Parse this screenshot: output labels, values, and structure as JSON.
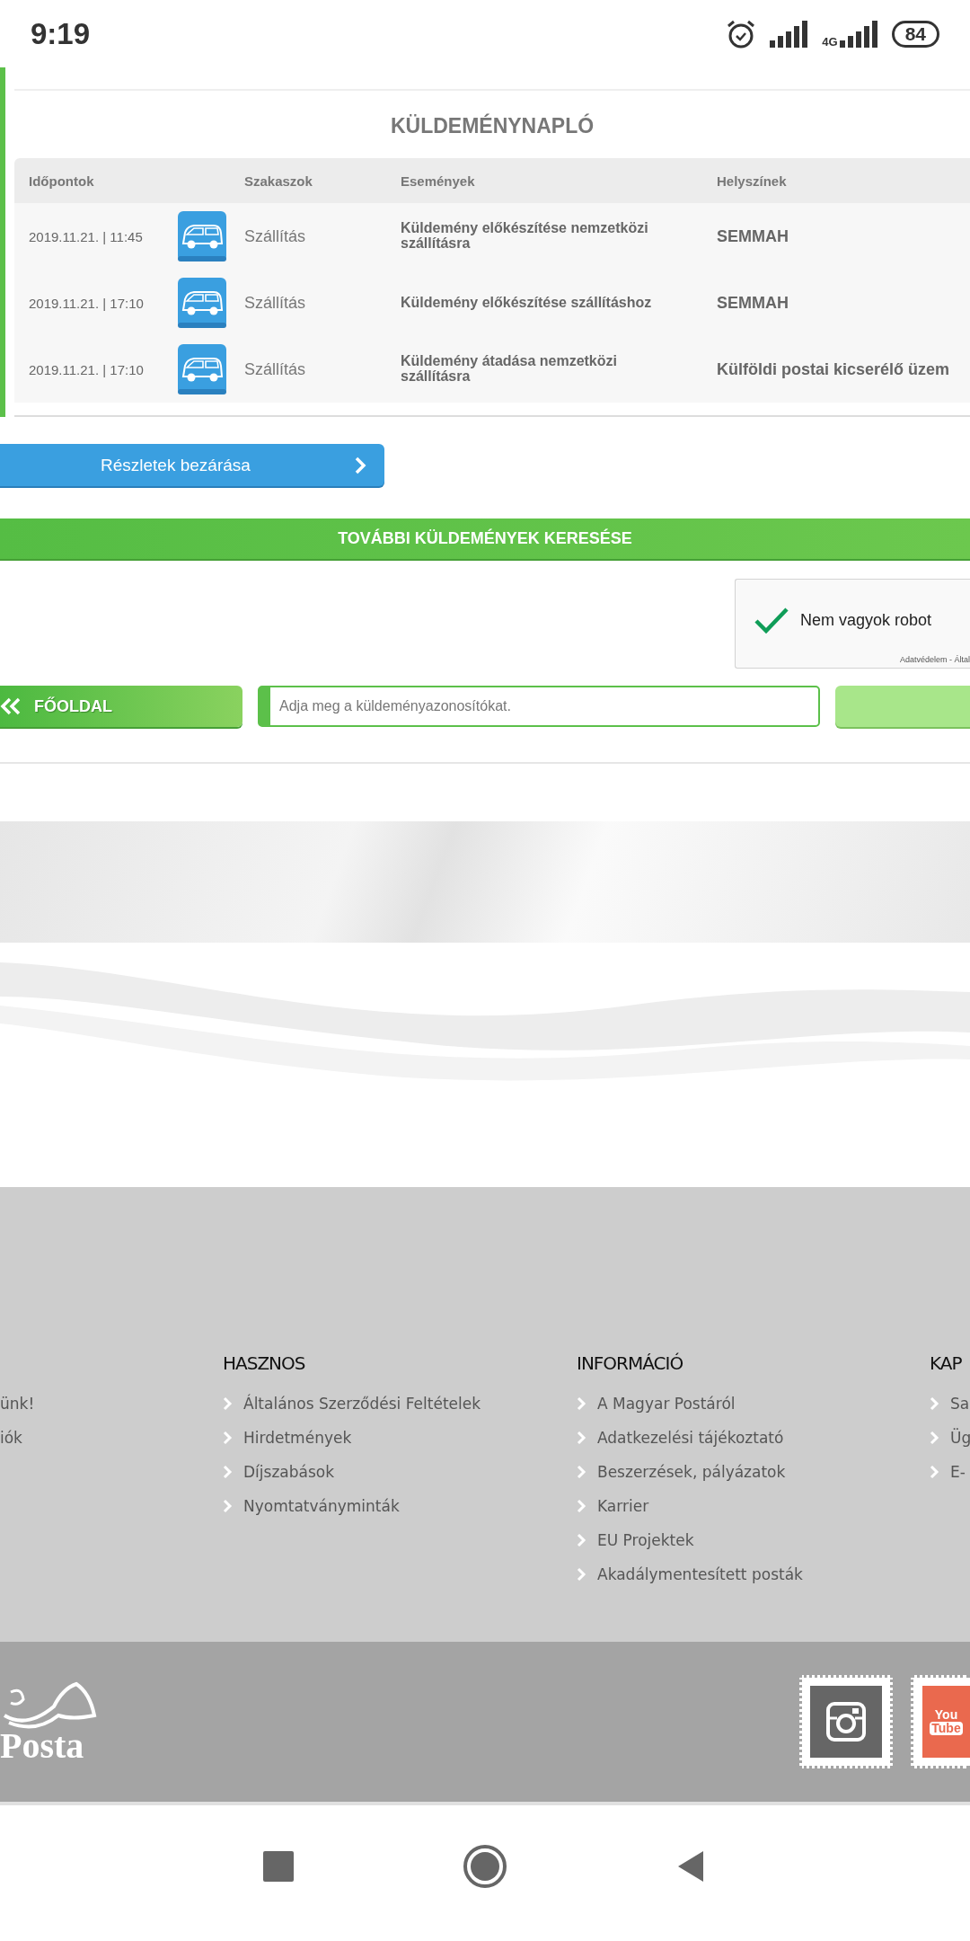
{
  "status_bar": {
    "time": "9:19",
    "network": "4G",
    "battery": "84"
  },
  "shipment_log": {
    "title": "KÜLDEMÉNYNAPLÓ",
    "columns": [
      "Időpontok",
      "Szakaszok",
      "Események",
      "Helyszínek"
    ],
    "rows": [
      {
        "time": "2019.11.21. | 11:45",
        "stage": "Szállítás",
        "event": "Küldemény előkészítése nemzetközi szállításra",
        "location": "SEMMAH"
      },
      {
        "time": "2019.11.21. | 17:10",
        "stage": "Szállítás",
        "event": "Küldemény előkészítése szállításhoz",
        "location": "SEMMAH"
      },
      {
        "time": "2019.11.21. | 17:10",
        "stage": "Szállítás",
        "event": "Küldemény átadása nemzetközi szállításra",
        "location": "Külföldi postai kicserélő üzem"
      }
    ]
  },
  "close_details_button": {
    "label": "Részletek bezárása"
  },
  "search_more_bar": {
    "label": "TOVÁBBI KÜLDEMÉNYEK KERESÉSE"
  },
  "recaptcha": {
    "label": "Nem vagyok robot",
    "checked": true,
    "footer": "Adatvédelem - Által"
  },
  "home_button": {
    "label": "FŐOLDAL"
  },
  "tracking_input": {
    "placeholder": "Adja meg a küldeményazonosítókat."
  },
  "footer": {
    "columns": [
      {
        "items": [
          "ünk!",
          "iók"
        ]
      },
      {
        "heading": "HASZNOS",
        "items": [
          "Általános Szerződési Feltételek",
          "Hirdetmények",
          "Díjszabások",
          "Nyomtatványminták"
        ]
      },
      {
        "heading": "INFORMÁCIÓ",
        "items": [
          "A Magyar Postáról",
          "Adatkezelési tájékoztató",
          "Beszerzések, pályázatok",
          "Karrier",
          "EU Projektek",
          "Akadálymentesített posták"
        ]
      },
      {
        "heading": "KAP",
        "items": [
          "Sa",
          "Üg",
          "E-"
        ]
      }
    ]
  },
  "bottom_band": {
    "logo_text": "Posta",
    "youtube_text": [
      "You",
      "Tube"
    ]
  }
}
